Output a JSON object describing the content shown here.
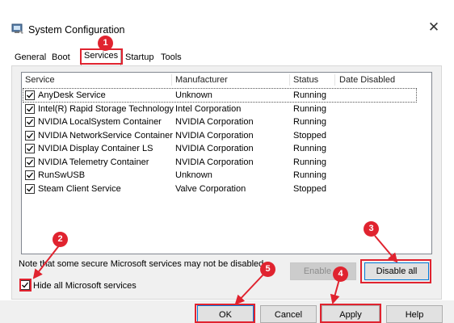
{
  "window": {
    "title": "System Configuration",
    "close": "✕"
  },
  "tabs": [
    {
      "label": "General"
    },
    {
      "label": "Boot"
    },
    {
      "label": "Services",
      "active": true
    },
    {
      "label": "Startup"
    },
    {
      "label": "Tools"
    }
  ],
  "columns": [
    "Service",
    "Manufacturer",
    "Status",
    "Date Disabled"
  ],
  "services": [
    {
      "name": "AnyDesk Service",
      "manufacturer": "Unknown",
      "status": "Running",
      "checked": true
    },
    {
      "name": "Intel(R) Rapid Storage Technology",
      "manufacturer": "Intel Corporation",
      "status": "Running",
      "checked": true
    },
    {
      "name": "NVIDIA LocalSystem Container",
      "manufacturer": "NVIDIA Corporation",
      "status": "Running",
      "checked": true
    },
    {
      "name": "NVIDIA NetworkService Container",
      "manufacturer": "NVIDIA Corporation",
      "status": "Stopped",
      "checked": true
    },
    {
      "name": "NVIDIA Display Container LS",
      "manufacturer": "NVIDIA Corporation",
      "status": "Running",
      "checked": true
    },
    {
      "name": "NVIDIA Telemetry Container",
      "manufacturer": "NVIDIA Corporation",
      "status": "Running",
      "checked": true
    },
    {
      "name": "RunSwUSB",
      "manufacturer": "Unknown",
      "status": "Running",
      "checked": true
    },
    {
      "name": "Steam Client Service",
      "manufacturer": "Valve Corporation",
      "status": "Stopped",
      "checked": true
    }
  ],
  "note": "Note that some secure Microsoft services may not be disabled.",
  "buttons": {
    "enable_all": "Enable all",
    "disable_all": "Disable all",
    "ok": "OK",
    "cancel": "Cancel",
    "apply": "Apply",
    "help": "Help"
  },
  "hide_ms": {
    "label": "Hide all Microsoft services",
    "checked": true
  },
  "annotations": [
    "1",
    "2",
    "3",
    "4",
    "5"
  ],
  "colors": {
    "annotation": "#e0232f",
    "focus_border": "#0078d7",
    "panel": "#f0f0f0"
  },
  "icons": {
    "app": "system-config-icon",
    "close": "close-icon",
    "checkbox": "check-icon"
  }
}
